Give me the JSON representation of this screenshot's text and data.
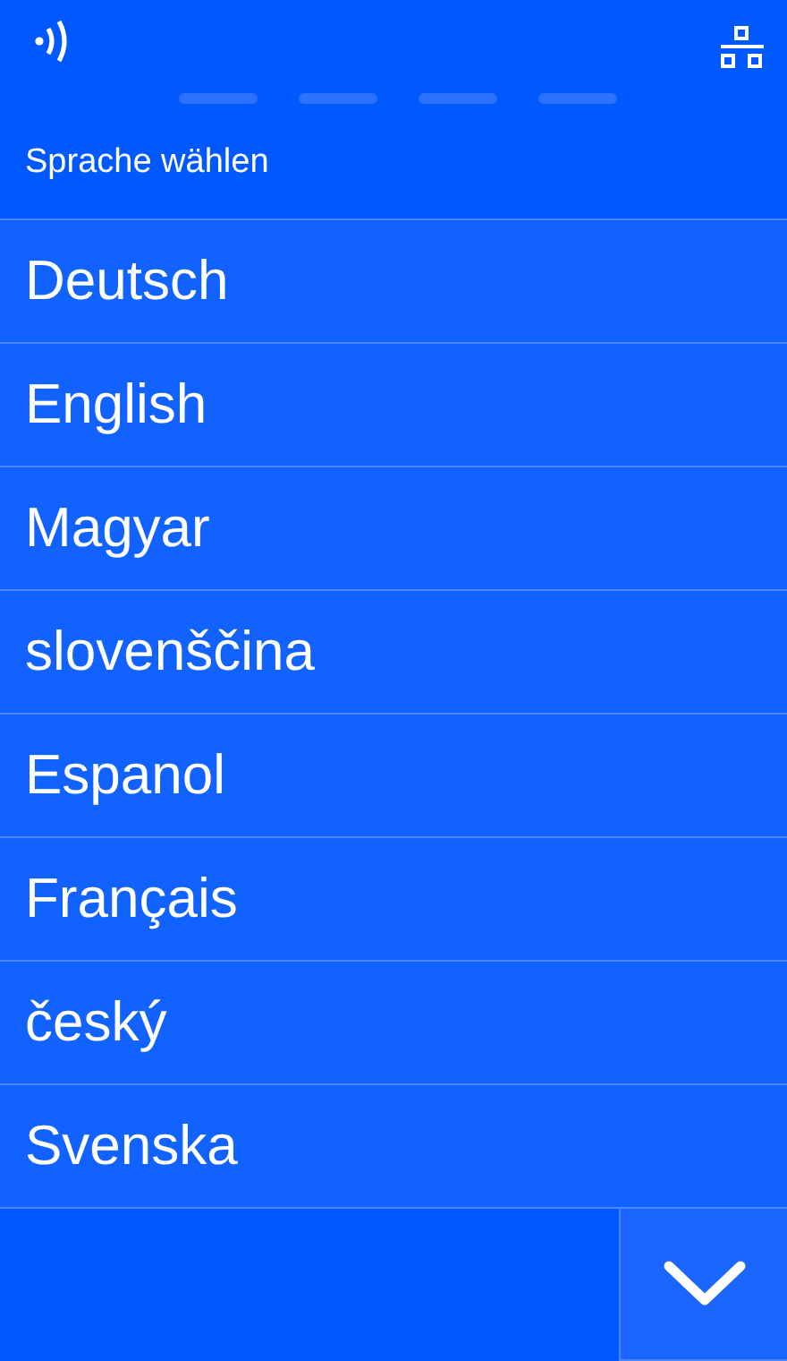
{
  "header": {
    "title": "Sprache wählen"
  },
  "languages": [
    {
      "label": "Deutsch"
    },
    {
      "label": "English"
    },
    {
      "label": "Magyar"
    },
    {
      "label": "slovenščina"
    },
    {
      "label": "Espanol"
    },
    {
      "label": "Français"
    },
    {
      "label": "český"
    },
    {
      "label": "Svenska"
    }
  ]
}
